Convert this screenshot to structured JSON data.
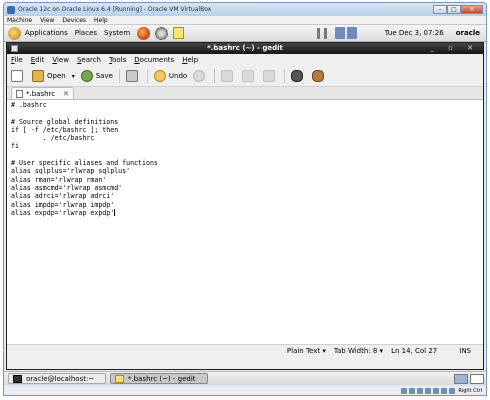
{
  "vbox": {
    "title": "Oracle 12c on Oracle Linux 6.4 [Running] - Oracle VM VirtualBox",
    "menu": [
      "Machine",
      "View",
      "Devices",
      "Help"
    ],
    "status_right": "Right Ctrl"
  },
  "panel": {
    "applications": "Applications",
    "places": "Places",
    "system": "System",
    "clock": "Tue Dec  3, 07:26",
    "user": "oracle"
  },
  "gedit": {
    "title": "*.bashrc (~) - gedit",
    "menu": [
      "File",
      "Edit",
      "View",
      "Search",
      "Tools",
      "Documents",
      "Help"
    ],
    "toolbar": {
      "open": "Open",
      "save": "Save",
      "undo": "Undo"
    },
    "tab_label": "*.bashrc",
    "lines": [
      "# .bashrc",
      "",
      "# Source global definitions",
      "if [ -f /etc/bashrc ]; then",
      "        . /etc/bashrc",
      "fi",
      "",
      "# User specific aliases and functions",
      "alias sqlplus='rlwrap sqlplus'",
      "alias rman='rlwrap rman'",
      "alias asmcmd='rlwrap asmcmd'",
      "alias adrci='rlwrap adrci'",
      "alias impdp='rlwrap impdp'",
      "alias expdp='rlwrap expdp'"
    ],
    "status": {
      "syntax": "Plain Text ▾",
      "tab_width": "Tab Width: 8 ▾",
      "position": "Ln 14, Col 27",
      "mode": "INS"
    }
  },
  "taskbar": {
    "items": [
      "oracle@localhost:~",
      "*.bashrc (~) - gedit"
    ]
  }
}
